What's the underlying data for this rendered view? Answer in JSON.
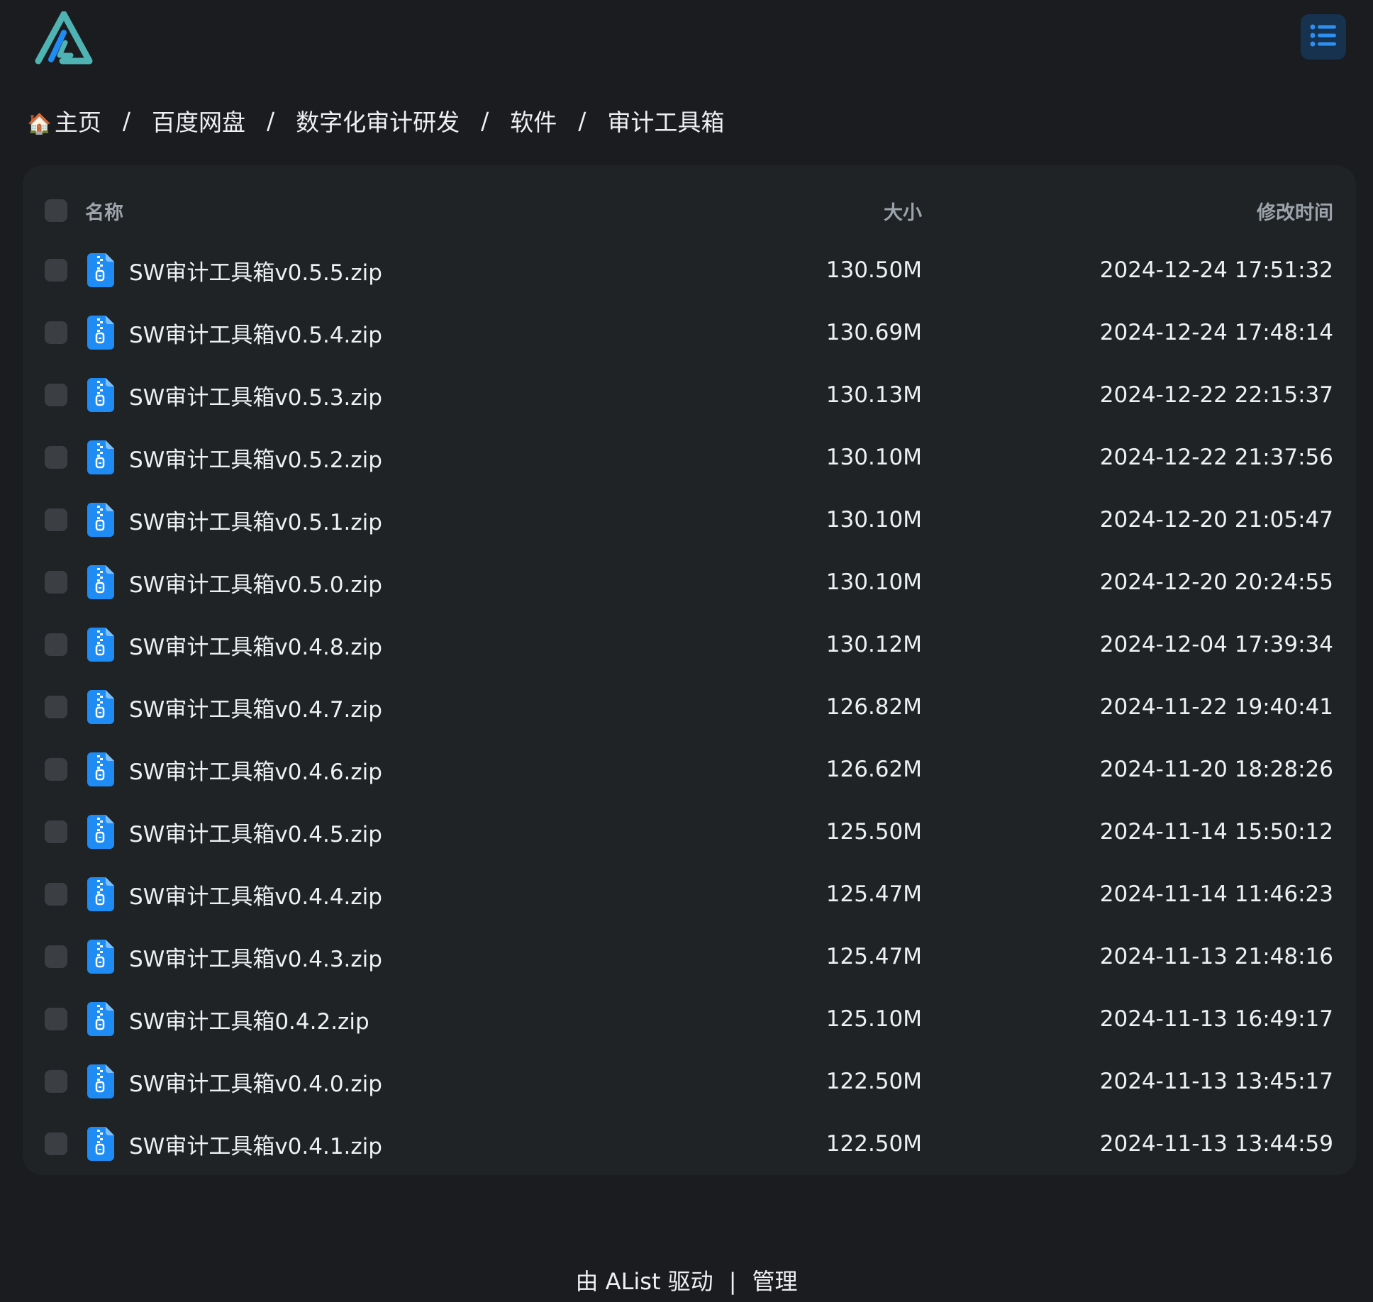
{
  "header": {
    "logo_icon": "alist-logo-icon",
    "menu_icon": "list-icon"
  },
  "breadcrumb": {
    "home_icon": "🏠",
    "items": [
      "主页",
      "百度网盘",
      "数字化审计研发",
      "软件",
      "审计工具箱"
    ],
    "separator": "/"
  },
  "table": {
    "columns": {
      "name": "名称",
      "size": "大小",
      "modified": "修改时间"
    },
    "file_icon": "zip-file-icon",
    "rows": [
      {
        "name": "SW审计工具箱v0.5.5.zip",
        "size": "130.50M",
        "modified": "2024-12-24 17:51:32"
      },
      {
        "name": "SW审计工具箱v0.5.4.zip",
        "size": "130.69M",
        "modified": "2024-12-24 17:48:14"
      },
      {
        "name": "SW审计工具箱v0.5.3.zip",
        "size": "130.13M",
        "modified": "2024-12-22 22:15:37"
      },
      {
        "name": "SW审计工具箱v0.5.2.zip",
        "size": "130.10M",
        "modified": "2024-12-22 21:37:56"
      },
      {
        "name": "SW审计工具箱v0.5.1.zip",
        "size": "130.10M",
        "modified": "2024-12-20 21:05:47"
      },
      {
        "name": "SW审计工具箱v0.5.0.zip",
        "size": "130.10M",
        "modified": "2024-12-20 20:24:55"
      },
      {
        "name": "SW审计工具箱v0.4.8.zip",
        "size": "130.12M",
        "modified": "2024-12-04 17:39:34"
      },
      {
        "name": "SW审计工具箱v0.4.7.zip",
        "size": "126.82M",
        "modified": "2024-11-22 19:40:41"
      },
      {
        "name": "SW审计工具箱v0.4.6.zip",
        "size": "126.62M",
        "modified": "2024-11-20 18:28:26"
      },
      {
        "name": "SW审计工具箱v0.4.5.zip",
        "size": "125.50M",
        "modified": "2024-11-14 15:50:12"
      },
      {
        "name": "SW审计工具箱v0.4.4.zip",
        "size": "125.47M",
        "modified": "2024-11-14 11:46:23"
      },
      {
        "name": "SW审计工具箱v0.4.3.zip",
        "size": "125.47M",
        "modified": "2024-11-13 21:48:16"
      },
      {
        "name": "SW审计工具箱0.4.2.zip",
        "size": "125.10M",
        "modified": "2024-11-13 16:49:17"
      },
      {
        "name": "SW审计工具箱v0.4.0.zip",
        "size": "122.50M",
        "modified": "2024-11-13 13:45:17"
      },
      {
        "name": "SW审计工具箱v0.4.1.zip",
        "size": "122.50M",
        "modified": "2024-11-13 13:44:59"
      }
    ]
  },
  "footer": {
    "powered_by": "由 AList 驱动",
    "separator": "|",
    "manage": "管理"
  },
  "colors": {
    "background": "#1a1c1f",
    "panel": "#202326",
    "accent": "#1f8cf5",
    "logo_teal": "#4fb3b3"
  }
}
